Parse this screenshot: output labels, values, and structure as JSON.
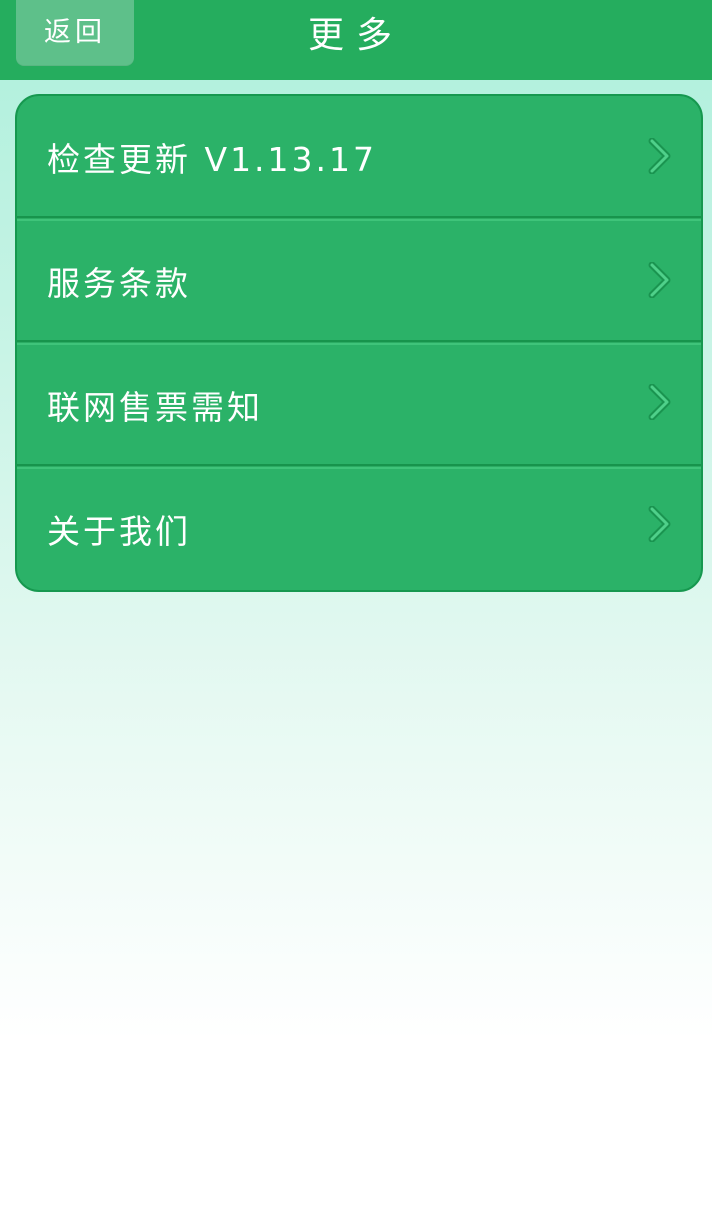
{
  "header": {
    "back_label": "返回",
    "title": "更多"
  },
  "menu": {
    "items": [
      {
        "label": "检查更新 V1.13.17"
      },
      {
        "label": "服务条款"
      },
      {
        "label": "联网售票需知"
      },
      {
        "label": "关于我们"
      }
    ]
  },
  "icons": {
    "chevron": "chevron-right-icon"
  },
  "colors": {
    "header": "#25ad5e",
    "back_button": "#5ec08a",
    "card": "#2bb268",
    "text": "#ffffff"
  }
}
